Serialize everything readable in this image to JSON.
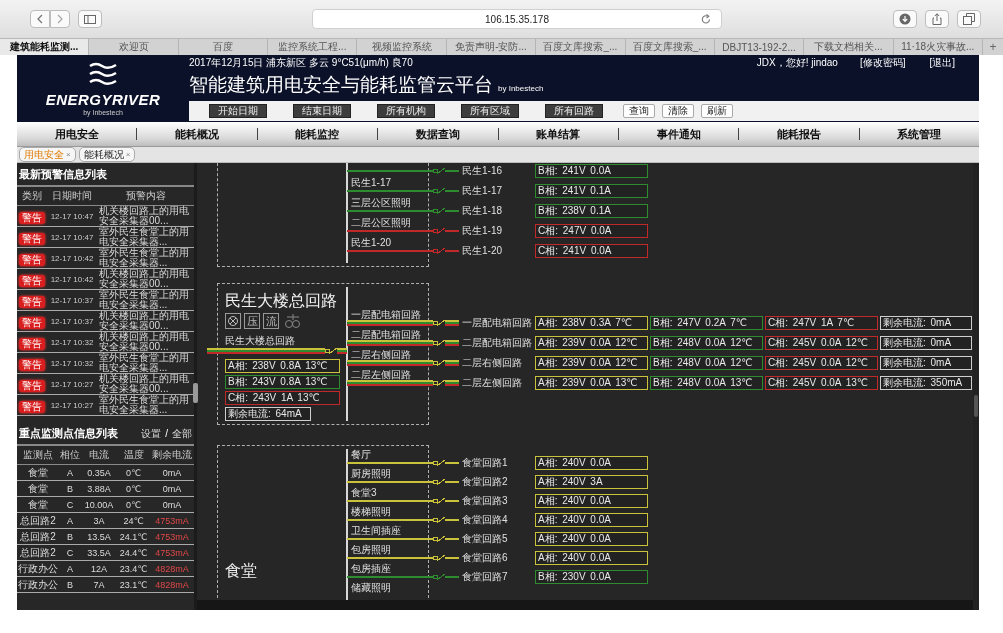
{
  "browser": {
    "url": "106.15.35.178",
    "tabs": [
      {
        "label": "建筑能耗监测...",
        "selected": true
      },
      {
        "label": "欢迎页",
        "selected": false
      },
      {
        "label": "百度",
        "selected": false
      },
      {
        "label": "监控系统工程...",
        "selected": false
      },
      {
        "label": "视频监控系统",
        "selected": false
      },
      {
        "label": "免责声明-安防...",
        "selected": false
      },
      {
        "label": "百度文库搜索_...",
        "selected": false
      },
      {
        "label": "百度文库搜索_...",
        "selected": false
      },
      {
        "label": "DBJT13-192-2...",
        "selected": false
      },
      {
        "label": "下载文档相关...",
        "selected": false
      },
      {
        "label": "11·18火灾事故...",
        "selected": false
      }
    ],
    "new_tab": "+"
  },
  "header": {
    "brand": "ENERGYRIVER",
    "brand_byline": "by Inbestech",
    "info_line": "2017年12月15日 浦东新区 多云 9°C51(μm/h) 良70",
    "title": "智能建筑用电安全与能耗监管云平台",
    "title_byline": "by Inbestech",
    "greeting": "JDX，您好! jindao",
    "user_links": [
      "[修改密码]",
      "[退出]"
    ],
    "filters": [
      "开始日期",
      "结束日期",
      "所有机构",
      "所有区域",
      "所有回路"
    ],
    "actions": [
      "查询",
      "清除",
      "刷新"
    ]
  },
  "nav": [
    "用电安全",
    "能耗概况",
    "能耗监控",
    "数据查询",
    "账单结算",
    "事件通知",
    "能耗报告",
    "系统管理"
  ],
  "page_tabs": [
    {
      "label": "用电安全",
      "close": "×",
      "selected": true
    },
    {
      "label": "能耗概况",
      "close": "×",
      "selected": false
    }
  ],
  "alerts": {
    "title": "最新预警信息列表",
    "columns": [
      "类别",
      "日期时间",
      "预警内容"
    ],
    "rows": [
      {
        "category": "警告",
        "time": "12-17 10:47",
        "content": "机关楼回路上的用电安全采集器00..."
      },
      {
        "category": "警告",
        "time": "12-17 10:47",
        "content": "室外民生食堂上的用电安全采集器..."
      },
      {
        "category": "警告",
        "time": "12-17 10:42",
        "content": "室外民生食堂上的用电安全采集器..."
      },
      {
        "category": "警告",
        "time": "12-17 10:42",
        "content": "机关楼回路上的用电安全采集器00..."
      },
      {
        "category": "警告",
        "time": "12-17 10:37",
        "content": "室外民生食堂上的用电安全采集器..."
      },
      {
        "category": "警告",
        "time": "12-17 10:37",
        "content": "机关楼回路上的用电安全采集器00..."
      },
      {
        "category": "警告",
        "time": "12-17 10:32",
        "content": "机关楼回路上的用电安全采集器00..."
      },
      {
        "category": "警告",
        "time": "12-17 10:32",
        "content": "室外民生食堂上的用电安全采集器..."
      },
      {
        "category": "警告",
        "time": "12-17 10:27",
        "content": "机关楼回路上的用电安全采集器00..."
      },
      {
        "category": "警告",
        "time": "12-17 10:27",
        "content": "室外民生食堂上的用电安全采集器..."
      }
    ]
  },
  "monitor": {
    "title": "重点监测点信息列表",
    "settings_link": "设置",
    "separator": "/",
    "all_link": "全部",
    "columns": [
      "监测点",
      "相位",
      "电流",
      "温度",
      "剩余电流"
    ],
    "rows": [
      {
        "point": "食堂",
        "phase": "A",
        "current": "0.35A",
        "temperature": "0℃",
        "residual": "0mA",
        "alarm": false
      },
      {
        "point": "食堂",
        "phase": "B",
        "current": "3.88A",
        "temperature": "0℃",
        "residual": "0mA",
        "alarm": false
      },
      {
        "point": "食堂",
        "phase": "C",
        "current": "10.00A",
        "temperature": "0℃",
        "residual": "0mA",
        "alarm": false
      },
      {
        "point": "总回路2",
        "phase": "A",
        "current": "3A",
        "temperature": "24℃",
        "residual": "4753mA",
        "alarm": true
      },
      {
        "point": "总回路2",
        "phase": "B",
        "current": "13.5A",
        "temperature": "24.1℃",
        "residual": "4753mA",
        "alarm": true
      },
      {
        "point": "总回路2",
        "phase": "C",
        "current": "33.5A",
        "temperature": "24.4℃",
        "residual": "4753mA",
        "alarm": true
      },
      {
        "point": "行政办公",
        "phase": "A",
        "current": "12A",
        "temperature": "23.4℃",
        "residual": "4828mA",
        "alarm": true
      },
      {
        "point": "行政办公",
        "phase": "B",
        "current": "7A",
        "temperature": "23.1℃",
        "residual": "4828mA",
        "alarm": true
      }
    ]
  },
  "diagram": {
    "sections": [
      {
        "branches": [
          {
            "right_label": "民生1-16",
            "kind": "single",
            "color": "#2e8b2e",
            "readings": [
              {
                "text": "B相: 241V 0.0A",
                "color": "#2e8b2e"
              }
            ]
          },
          {
            "left_label": "民生1-17",
            "right_label": "民生1-17",
            "kind": "single",
            "color": "#2e8b2e",
            "readings": [
              {
                "text": "B相: 241V 0.1A",
                "color": "#2e8b2e"
              }
            ]
          },
          {
            "left_label": "三层公区照明",
            "right_label": "民生1-18",
            "kind": "single",
            "color": "#2e8b2e",
            "readings": [
              {
                "text": "B相: 238V 0.1A",
                "color": "#2e8b2e"
              }
            ]
          },
          {
            "left_label": "二层公区照明",
            "right_label": "民生1-19",
            "kind": "single",
            "color": "#c0282a",
            "readings": [
              {
                "text": "C相: 247V 0.0A",
                "color": "#c0282a"
              }
            ]
          },
          {
            "left_label": "民生1-20",
            "right_label": "民生1-20",
            "kind": "single",
            "color": "#c0282a",
            "readings": [
              {
                "text": "C相: 241V 0.0A",
                "color": "#c0282a"
              }
            ]
          }
        ]
      },
      {
        "title": "民生大楼总回路",
        "meters": [
          "压",
          "流"
        ],
        "feed": {
          "label": "民生大楼总回路",
          "readings": [
            {
              "text": "A相: 238V 0.8A 13℃",
              "color": "#c9c23a"
            },
            {
              "text": "B相: 243V 0.8A 13℃",
              "color": "#2e8b2e"
            },
            {
              "text": "C相: 243V 1A 13℃",
              "color": "#c0282a"
            },
            {
              "text": "剩余电流: 64mA",
              "color": "#cfcfcf"
            }
          ]
        },
        "branches": [
          {
            "left_label": "一层配电箱回路",
            "right_label": "一层配电箱回路",
            "kind": "three-phase",
            "readings": [
              {
                "text": "A相: 238V 0.3A 7℃",
                "color": "#c9c23a"
              },
              {
                "text": "B相: 247V 0.2A 7℃",
                "color": "#2e8b2e"
              },
              {
                "text": "C相: 247V 1A 7℃",
                "color": "#c0282a"
              },
              {
                "text": "剩余电流: 0mA",
                "color": "#cfcfcf"
              }
            ]
          },
          {
            "left_label": "二层配电箱回路",
            "right_label": "二层配电箱回路",
            "kind": "three-phase",
            "readings": [
              {
                "text": "A相: 239V 0.0A 12℃",
                "color": "#c9c23a"
              },
              {
                "text": "B相: 248V 0.0A 12℃",
                "color": "#2e8b2e"
              },
              {
                "text": "C相: 245V 0.0A 12℃",
                "color": "#c0282a"
              },
              {
                "text": "剩余电流: 0mA",
                "color": "#cfcfcf"
              }
            ]
          },
          {
            "left_label": "二层右侧回路",
            "right_label": "二层右侧回路",
            "kind": "three-phase",
            "readings": [
              {
                "text": "A相: 239V 0.0A 12℃",
                "color": "#c9c23a"
              },
              {
                "text": "B相: 248V 0.0A 12℃",
                "color": "#2e8b2e"
              },
              {
                "text": "C相: 245V 0.0A 12℃",
                "color": "#c0282a"
              },
              {
                "text": "剩余电流: 0mA",
                "color": "#cfcfcf"
              }
            ]
          },
          {
            "left_label": "二层左侧回路",
            "right_label": "二层左侧回路",
            "kind": "three-phase",
            "readings": [
              {
                "text": "A相: 239V 0.0A 13℃",
                "color": "#c9c23a"
              },
              {
                "text": "B相: 248V 0.0A 13℃",
                "color": "#2e8b2e"
              },
              {
                "text": "C相: 245V 0.0A 13℃",
                "color": "#c0282a"
              },
              {
                "text": "剩余电流: 350mA",
                "color": "#cfcfcf"
              }
            ]
          }
        ]
      },
      {
        "title": "食堂",
        "trailing_label": "储藏照明",
        "branches": [
          {
            "left_label": "餐厅",
            "right_label": "食堂回路1",
            "kind": "single",
            "color": "#c9c23a",
            "readings": [
              {
                "text": "A相: 240V 0.0A",
                "color": "#c9c23a"
              }
            ]
          },
          {
            "left_label": "厨房照明",
            "right_label": "食堂回路2",
            "kind": "single",
            "color": "#c9c23a",
            "readings": [
              {
                "text": "A相: 240V 3A",
                "color": "#c9c23a"
              }
            ]
          },
          {
            "left_label": "食堂3",
            "right_label": "食堂回路3",
            "kind": "single",
            "color": "#c9c23a",
            "readings": [
              {
                "text": "A相: 240V 0.0A",
                "color": "#c9c23a"
              }
            ]
          },
          {
            "left_label": "楼梯照明",
            "right_label": "食堂回路4",
            "kind": "single",
            "color": "#c9c23a",
            "readings": [
              {
                "text": "A相: 240V 0.0A",
                "color": "#c9c23a"
              }
            ]
          },
          {
            "left_label": "卫生间插座",
            "right_label": "食堂回路5",
            "kind": "single",
            "color": "#c9c23a",
            "readings": [
              {
                "text": "A相: 240V 0.0A",
                "color": "#c9c23a"
              }
            ]
          },
          {
            "left_label": "包房照明",
            "right_label": "食堂回路6",
            "kind": "single",
            "color": "#c9c23a",
            "readings": [
              {
                "text": "A相: 240V 0.0A",
                "color": "#c9c23a"
              }
            ]
          },
          {
            "left_label": "包房插座",
            "right_label": "食堂回路7",
            "kind": "single",
            "color": "#2e8b2e",
            "readings": [
              {
                "text": "B相: 230V 0.0A",
                "color": "#2e8b2e"
              }
            ]
          }
        ]
      }
    ]
  }
}
